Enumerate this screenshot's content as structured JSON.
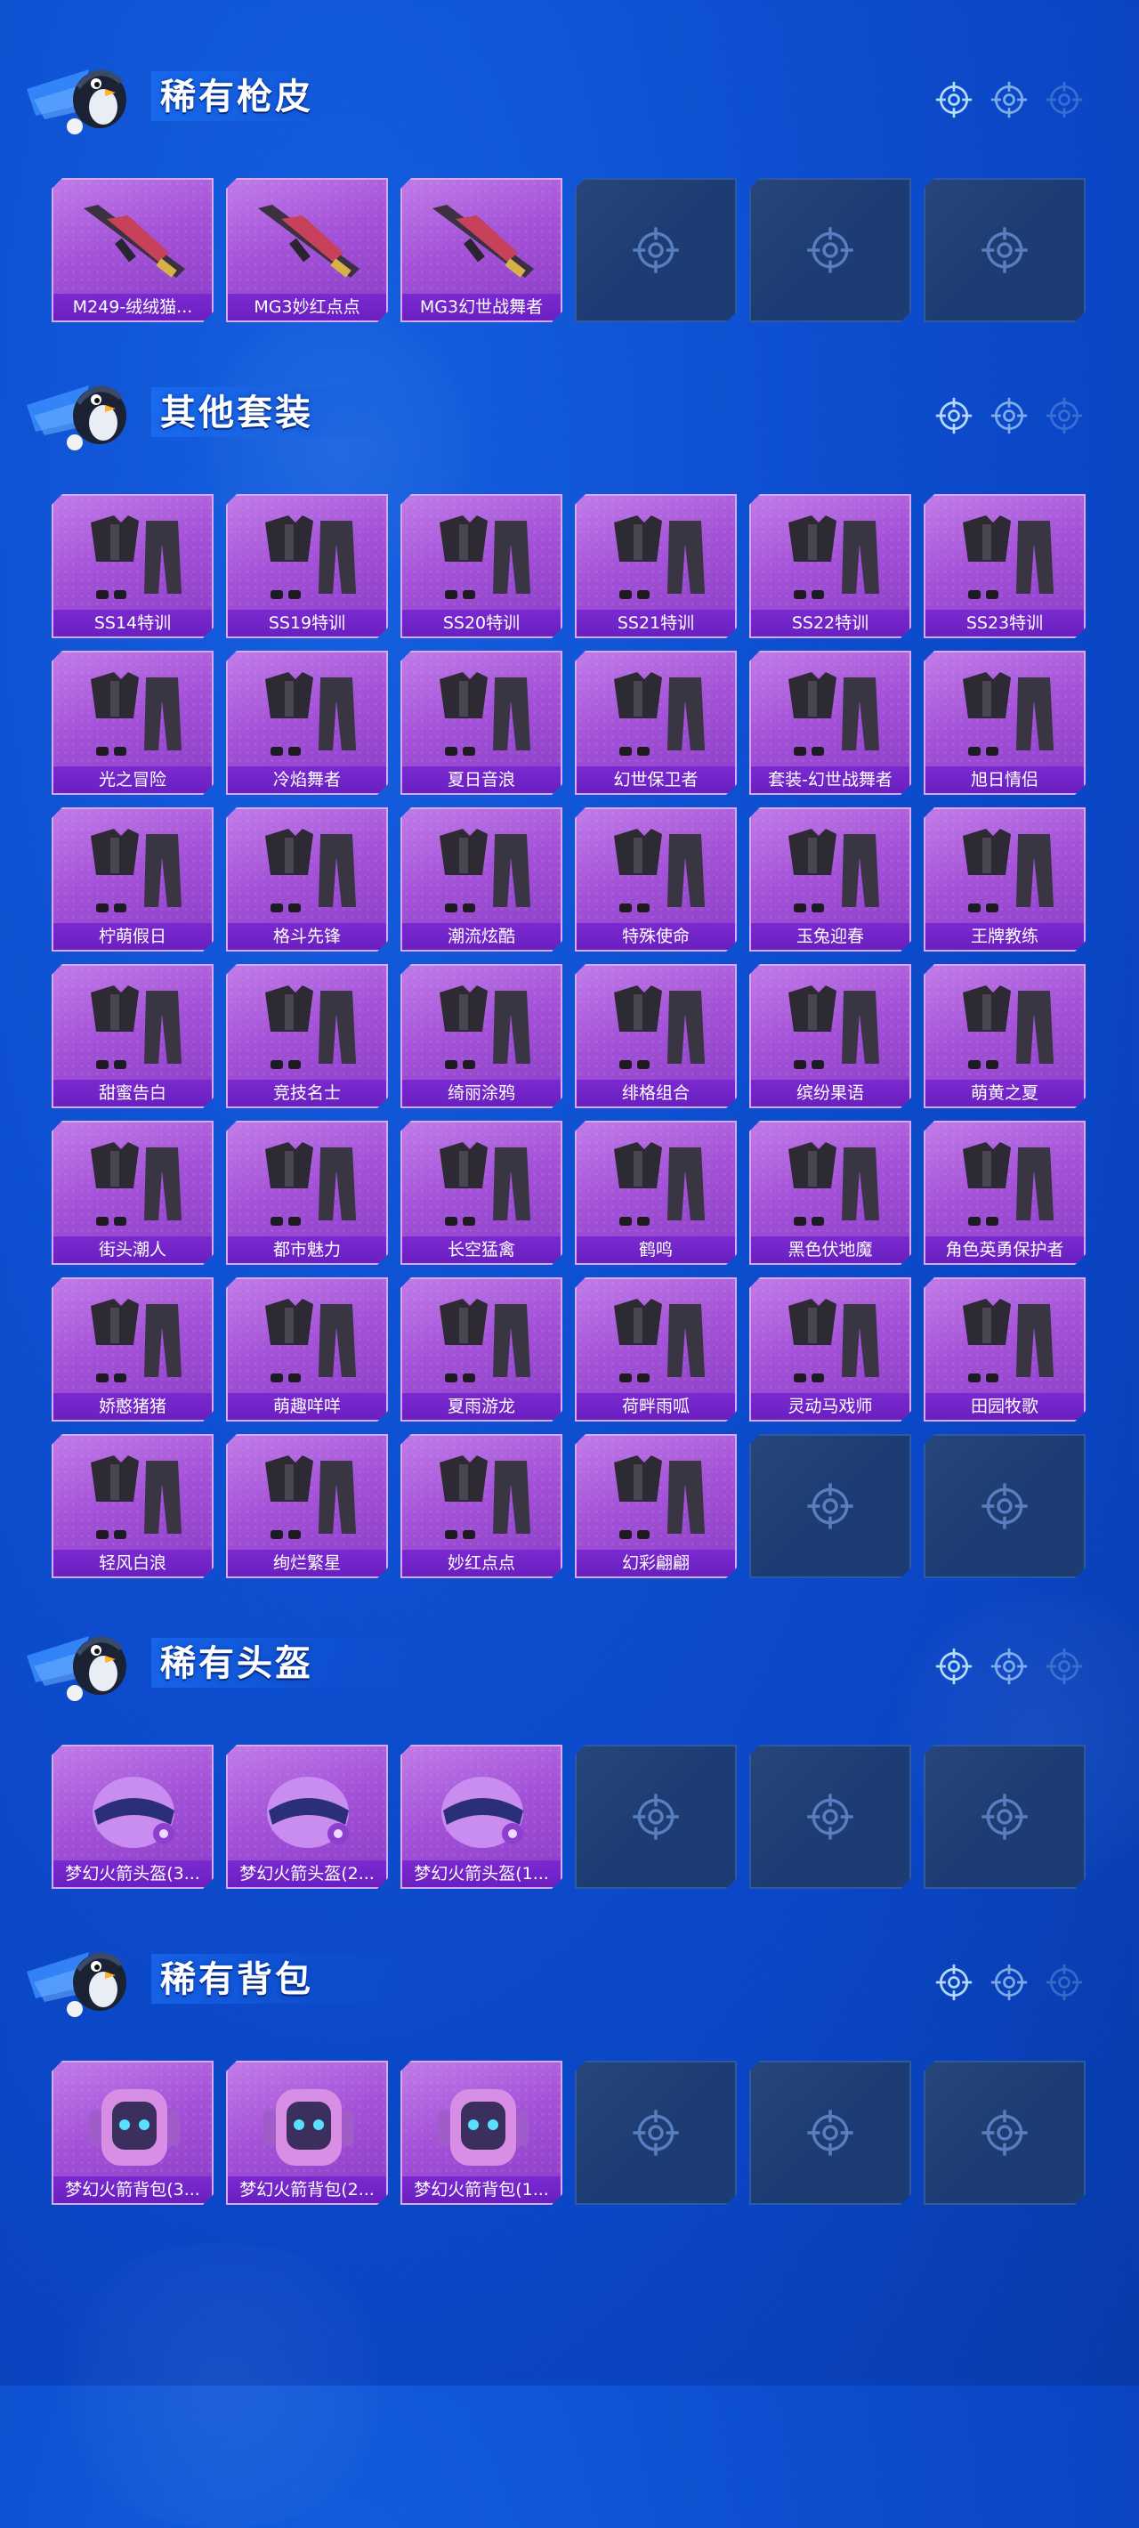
{
  "colors": {
    "background": "#0d4fd0",
    "tile_purple": "#a453d8",
    "label_bar": "#6a1fc0",
    "tile_empty": "#1c3c73",
    "text": "#ffffff"
  },
  "icons": {
    "header_mascot": "penguin-mascot-icon",
    "header_targets": "crosshair-icon",
    "empty_slot": "crosshair-icon"
  },
  "sections": [
    {
      "title": "稀有枪皮",
      "items": [
        {
          "label": "M249-绒绒猫...",
          "type": "gun"
        },
        {
          "label": "MG3妙红点点",
          "type": "gun"
        },
        {
          "label": "MG3幻世战舞者",
          "type": "gun"
        },
        {
          "empty": true
        },
        {
          "empty": true
        },
        {
          "empty": true
        }
      ]
    },
    {
      "title": "其他套装",
      "items": [
        {
          "label": "SS14特训",
          "type": "outfit"
        },
        {
          "label": "SS19特训",
          "type": "outfit"
        },
        {
          "label": "SS20特训",
          "type": "outfit"
        },
        {
          "label": "SS21特训",
          "type": "outfit"
        },
        {
          "label": "SS22特训",
          "type": "outfit"
        },
        {
          "label": "SS23特训",
          "type": "outfit"
        },
        {
          "label": "光之冒险",
          "type": "outfit"
        },
        {
          "label": "冷焰舞者",
          "type": "outfit"
        },
        {
          "label": "夏日音浪",
          "type": "outfit"
        },
        {
          "label": "幻世保卫者",
          "type": "outfit"
        },
        {
          "label": "套装-幻世战舞者",
          "type": "outfit"
        },
        {
          "label": "旭日情侣",
          "type": "outfit"
        },
        {
          "label": "柠萌假日",
          "type": "outfit"
        },
        {
          "label": "格斗先锋",
          "type": "outfit"
        },
        {
          "label": "潮流炫酷",
          "type": "outfit"
        },
        {
          "label": "特殊使命",
          "type": "outfit"
        },
        {
          "label": "玉兔迎春",
          "type": "outfit"
        },
        {
          "label": "王牌教练",
          "type": "outfit"
        },
        {
          "label": "甜蜜告白",
          "type": "outfit"
        },
        {
          "label": "竞技名士",
          "type": "outfit"
        },
        {
          "label": "绮丽涂鸦",
          "type": "outfit"
        },
        {
          "label": "绯格组合",
          "type": "outfit"
        },
        {
          "label": "缤纷果语",
          "type": "outfit"
        },
        {
          "label": "萌黄之夏",
          "type": "outfit"
        },
        {
          "label": "街头潮人",
          "type": "outfit"
        },
        {
          "label": "都市魅力",
          "type": "outfit"
        },
        {
          "label": "长空猛禽",
          "type": "outfit"
        },
        {
          "label": "鹤鸣",
          "type": "outfit"
        },
        {
          "label": "黑色伏地魔",
          "type": "outfit"
        },
        {
          "label": "角色英勇保护者",
          "type": "outfit"
        },
        {
          "label": "娇憨猪猪",
          "type": "outfit"
        },
        {
          "label": "萌趣咩咩",
          "type": "outfit"
        },
        {
          "label": "夏雨游龙",
          "type": "outfit"
        },
        {
          "label": "荷畔雨呱",
          "type": "outfit"
        },
        {
          "label": "灵动马戏师",
          "type": "outfit"
        },
        {
          "label": "田园牧歌",
          "type": "outfit"
        },
        {
          "label": "轻风白浪",
          "type": "outfit"
        },
        {
          "label": "绚烂繁星",
          "type": "outfit"
        },
        {
          "label": "妙红点点",
          "type": "outfit"
        },
        {
          "label": "幻彩翩翩",
          "type": "outfit"
        },
        {
          "empty": true
        },
        {
          "empty": true
        }
      ]
    },
    {
      "title": "稀有头盔",
      "items": [
        {
          "label": "梦幻火箭头盔(3...",
          "type": "helmet"
        },
        {
          "label": "梦幻火箭头盔(2...",
          "type": "helmet"
        },
        {
          "label": "梦幻火箭头盔(1...",
          "type": "helmet"
        },
        {
          "empty": true
        },
        {
          "empty": true
        },
        {
          "empty": true
        }
      ]
    },
    {
      "title": "稀有背包",
      "items": [
        {
          "label": "梦幻火箭背包(3...",
          "type": "backpack"
        },
        {
          "label": "梦幻火箭背包(2...",
          "type": "backpack"
        },
        {
          "label": "梦幻火箭背包(1...",
          "type": "backpack"
        },
        {
          "empty": true
        },
        {
          "empty": true
        },
        {
          "empty": true
        }
      ]
    }
  ]
}
